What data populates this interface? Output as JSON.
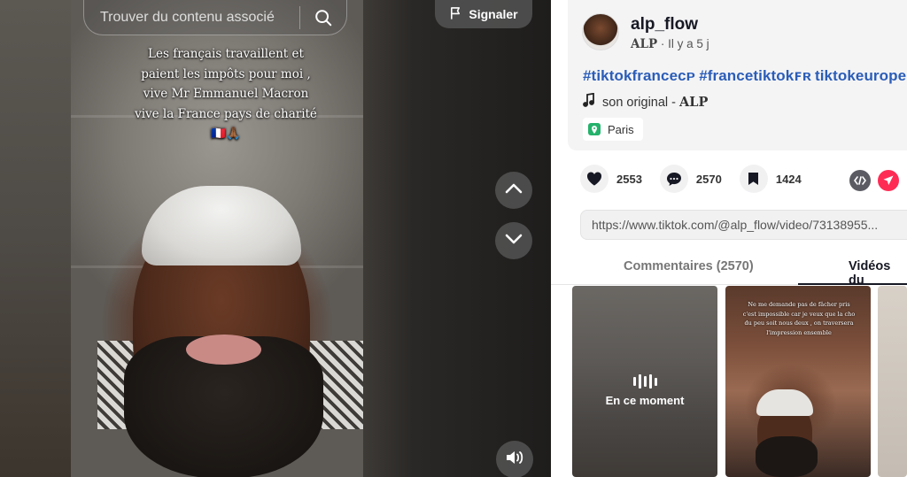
{
  "search": {
    "placeholder": "Trouver du contenu associé"
  },
  "report": {
    "label": "Signaler"
  },
  "video": {
    "caption": "Les français travaillent et\npaient les impôts pour moi ,\nvive Mr Emmanuel Macron\nvive la France pays de charité\n🇫🇷🙏🏾"
  },
  "author": {
    "username": "alp_flow",
    "nickname": "ALP",
    "separator": "·",
    "time_ago": "Il y a 5 j"
  },
  "description": {
    "hashtags": [
      "#tiktokfranceᴄᴘ",
      "#francetiktokꜰʀ",
      "tiktokeurope"
    ]
  },
  "music": {
    "title": "son original - ",
    "artist": "ALP"
  },
  "location": {
    "name": "Paris"
  },
  "actions": {
    "likes": "2553",
    "comments": "2570",
    "saves": "1424"
  },
  "share_url": "https://www.tiktok.com/@alp_flow/video/73138955...",
  "tabs": {
    "comments": "Commentaires (2570)",
    "creator_videos": "Vidéos du"
  },
  "related": {
    "now_playing": "En ce moment",
    "thumb2_caption": "Ne me demande pas de fâcher pris c'est impossible car je veux que la cho du peu soit nous deux , on traversera l'impression ensemble"
  },
  "colors": {
    "hashtag": "#2b5db8",
    "accent": "#fe2c55",
    "location_icon": "#25b26b"
  }
}
